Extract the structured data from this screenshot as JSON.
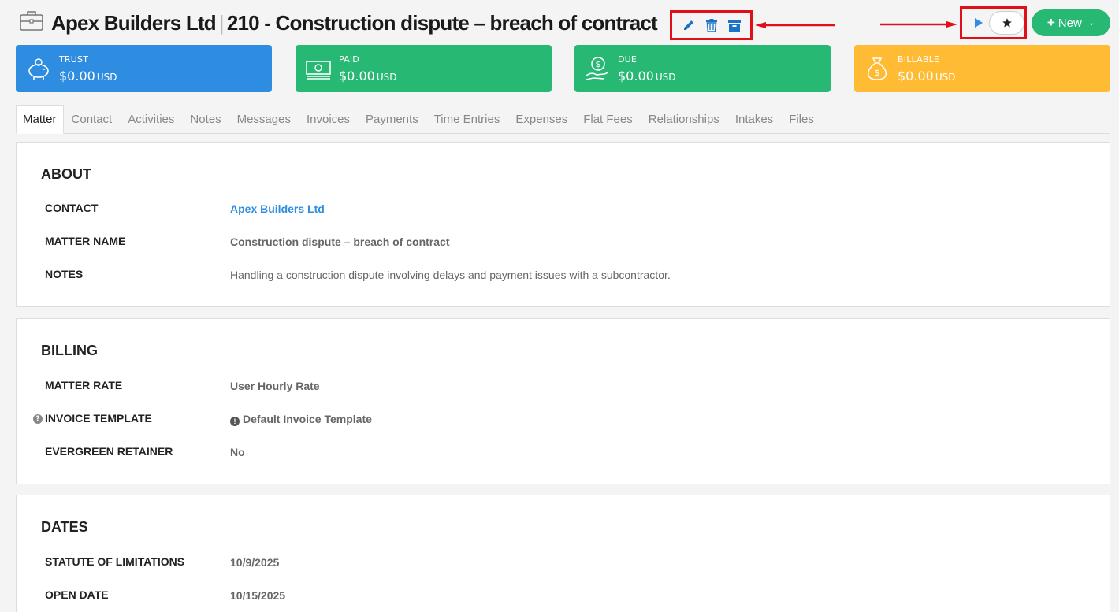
{
  "header": {
    "contact_name": "Apex Builders Ltd",
    "separator": "|",
    "matter_title": "210 - Construction dispute – breach of contract",
    "new_label": "New"
  },
  "icons": {
    "header": "briefcase-icon",
    "edit": "pencil-icon",
    "delete": "trash-icon",
    "archive": "archive-icon",
    "timer": "play-icon",
    "favorite": "star-icon"
  },
  "colors": {
    "trust": "#2e8de0",
    "paid": "#27b874",
    "due": "#27b874",
    "billable": "#ffbb33",
    "annotation": "#e0101a",
    "link": "#2e8de0"
  },
  "cards": [
    {
      "label": "TRUST",
      "amount": "$0.00",
      "currency": "USD",
      "icon": "piggy-bank-icon"
    },
    {
      "label": "PAID",
      "amount": "$0.00",
      "currency": "USD",
      "icon": "cash-icon"
    },
    {
      "label": "DUE",
      "amount": "$0.00",
      "currency": "USD",
      "icon": "dollar-hand-icon"
    },
    {
      "label": "BILLABLE",
      "amount": "$0.00",
      "currency": "USD",
      "icon": "money-bag-icon"
    }
  ],
  "tabs": [
    "Matter",
    "Contact",
    "Activities",
    "Notes",
    "Messages",
    "Invoices",
    "Payments",
    "Time Entries",
    "Expenses",
    "Flat Fees",
    "Relationships",
    "Intakes",
    "Files"
  ],
  "about": {
    "heading": "ABOUT",
    "contact_label": "CONTACT",
    "contact_value": "Apex Builders Ltd",
    "matter_name_label": "MATTER NAME",
    "matter_name_value": "Construction dispute – breach of contract",
    "notes_label": "NOTES",
    "notes_value": "Handling a construction dispute involving delays and payment issues with a subcontractor."
  },
  "billing": {
    "heading": "BILLING",
    "rate_label": "MATTER RATE",
    "rate_value": "User Hourly Rate",
    "template_label": "INVOICE TEMPLATE",
    "template_value": "Default Invoice Template",
    "retainer_label": "EVERGREEN RETAINER",
    "retainer_value": "No"
  },
  "dates": {
    "heading": "DATES",
    "statute_label": "STATUTE OF LIMITATIONS",
    "statute_value": "10/9/2025",
    "open_label": "OPEN DATE",
    "open_value": "10/15/2025"
  }
}
